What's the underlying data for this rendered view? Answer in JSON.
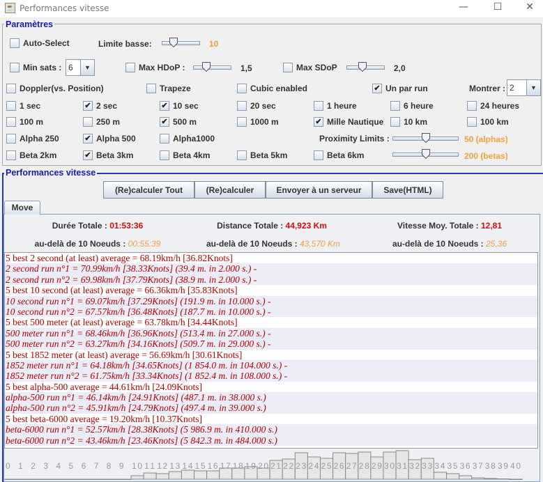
{
  "window": {
    "title": "Performances vitesse",
    "minimize": "—",
    "maximize": "☐",
    "close": "✕"
  },
  "params": {
    "title": "Paramètres",
    "auto_select": {
      "label": "Auto-Select",
      "checked": false
    },
    "limite_basse": {
      "label": "Limite basse:",
      "value": "10",
      "level": 0.25
    },
    "min_sats": {
      "label": "Min sats :",
      "checked": false,
      "value": "6"
    },
    "max_hdop": {
      "label": "Max HDoP :",
      "checked": false,
      "value": "1,5",
      "level": 0.3
    },
    "max_sdop": {
      "label": "Max SDoP",
      "checked": false,
      "value": "2,0",
      "level": 0.4
    },
    "doppler": {
      "label": "Doppler(vs. Position)",
      "checked": false
    },
    "trapeze": {
      "label": "Trapeze",
      "checked": false
    },
    "cubic": {
      "label": "Cubic enabled",
      "checked": false
    },
    "un_par_run": {
      "label": "Un par run",
      "checked": true
    },
    "montrer": {
      "label": "Montrer :",
      "value": "2"
    },
    "rows": [
      [
        {
          "label": "1 sec",
          "checked": false
        },
        {
          "label": "2 sec",
          "checked": true
        },
        {
          "label": "10 sec",
          "checked": true
        },
        {
          "label": "20 sec",
          "checked": false
        },
        {
          "label": "1 heure",
          "checked": false
        },
        {
          "label": "6 heure",
          "checked": false
        },
        {
          "label": "24 heures",
          "checked": false
        }
      ],
      [
        {
          "label": "100 m",
          "checked": false
        },
        {
          "label": "250 m",
          "checked": false
        },
        {
          "label": "500 m",
          "checked": true
        },
        {
          "label": "1000 m",
          "checked": false
        },
        {
          "label": "Mille Nautique",
          "checked": true
        },
        {
          "label": "10 km",
          "checked": false
        },
        {
          "label": "100 km",
          "checked": false
        }
      ],
      [
        {
          "label": "Alpha 250",
          "checked": false
        },
        {
          "label": "Alpha 500",
          "checked": true
        },
        {
          "label": "Alpha1000",
          "checked": false
        }
      ],
      [
        {
          "label": "Beta 2km",
          "checked": false
        },
        {
          "label": "Beta 3km",
          "checked": true
        },
        {
          "label": "Beta 4km",
          "checked": false
        },
        {
          "label": "Beta 5km",
          "checked": false
        },
        {
          "label": "Beta 6km",
          "checked": false
        }
      ]
    ],
    "proximity": {
      "label": "Proximity Limits :",
      "alpha_value": "50 (alphas)",
      "alpha_level": 0.5,
      "beta_value": "200 (betas)",
      "beta_level": 0.5
    }
  },
  "perf": {
    "title": "Performances vitesse",
    "buttons": [
      "(Re)calculer Tout",
      "(Re)calculer",
      "Envoyer à un serveur",
      "Save(HTML)"
    ],
    "tab": "Move",
    "stats": [
      {
        "label": "Durée Totale : ",
        "value": "01:53:36"
      },
      {
        "label": "Distance Totale : ",
        "value": "44,923 Km"
      },
      {
        "label": "Vitesse Moy. Totale : ",
        "value": "12,81"
      }
    ],
    "beyond": [
      {
        "label": "au-delà de  10 Noeuds : ",
        "value": "00:55:39"
      },
      {
        "label": "au-delà de  10 Noeuds : ",
        "value": "43,570 Km"
      },
      {
        "label": "au-delà de  10 Noeuds : ",
        "value": "25,36"
      }
    ],
    "lines": [
      {
        "text": "5 best 2 second (at least) average = 68.19km/h [36.82Knots]",
        "run": false
      },
      {
        "text": "2 second run n°1 = 70.99km/h [38.33Knots] (39.4 m. in 2.000 s.) -",
        "run": true
      },
      {
        "text": "2 second run n°2 = 69.98km/h [37.79Knots] (38.9 m. in 2.000 s.) -",
        "run": true
      },
      {
        "text": "5 best 10 second (at least) average = 66.36km/h [35.83Knots]",
        "run": false
      },
      {
        "text": "10 second run n°1 = 69.07km/h [37.29Knots] (191.9 m. in 10.000 s.) -",
        "run": true
      },
      {
        "text": "10 second run n°2 = 67.57km/h [36.48Knots] (187.7 m. in 10.000 s.) -",
        "run": true
      },
      {
        "text": "5 best 500 meter (at least) average = 63.78km/h [34.44Knots]",
        "run": false
      },
      {
        "text": "500 meter run n°1 = 68.46km/h [36.96Knots] (513.4 m. in 27.000 s.) -",
        "run": true
      },
      {
        "text": "500 meter run n°2 = 63.27km/h [34.16Knots] (509.7 m. in 29.000 s.) -",
        "run": true
      },
      {
        "text": "5 best 1852 meter (at least) average = 56.69km/h [30.61Knots]",
        "run": false
      },
      {
        "text": "1852 meter run n°1 = 64.18km/h [34.65Knots] (1 854.0 m. in 104.000 s.) -",
        "run": true
      },
      {
        "text": "1852 meter run n°2 = 61.75km/h [33.34Knots] (1 852.4 m. in 108.000 s.) -",
        "run": true
      },
      {
        "text": "5 best alpha-500 average = 44.61km/h [24.09Knots]",
        "run": false
      },
      {
        "text": "alpha-500 run n°1 = 46.14km/h [24.91Knots] (487.1 m. in 38.000 s.)",
        "run": true
      },
      {
        "text": "alpha-500 run n°2 = 45.91km/h [24.79Knots] (497.4 m. in 39.000 s.)",
        "run": true
      },
      {
        "text": "5 best beta-6000 average = 19.20km/h [10.37Knots]",
        "run": false
      },
      {
        "text": "beta-6000 run n°1 = 52.57km/h [28.38Knots] (5 986.9 m. in 410.000 s.)",
        "run": true
      },
      {
        "text": "beta-6000 run n°2 = 43.46km/h [23.46Knots] (5 842.3 m. in 484.000 s.)",
        "run": true
      }
    ]
  },
  "chart_data": {
    "type": "bar",
    "categories": [
      "0",
      "1",
      "2",
      "3",
      "4",
      "5",
      "6",
      "7",
      "8",
      "9",
      "10",
      "11",
      "12",
      "13",
      "14",
      "15",
      "16",
      "17",
      "18",
      "19",
      "20",
      "21",
      "22",
      "23",
      "24",
      "25",
      "26",
      "27",
      "28",
      "29",
      "30",
      "31",
      "32",
      "33",
      "34",
      "35",
      "36",
      "37",
      "38",
      "39",
      "40"
    ],
    "values": [
      0,
      0,
      0,
      0,
      0,
      0,
      0,
      0,
      0,
      0,
      5,
      9,
      8,
      11,
      13,
      12,
      12,
      16,
      16,
      18,
      16,
      27,
      29,
      38,
      32,
      30,
      38,
      37,
      39,
      32,
      39,
      41,
      28,
      30,
      10,
      8,
      5,
      2,
      1,
      0.5,
      0
    ],
    "ylim": [
      0,
      42
    ],
    "grid": false,
    "bar_color": "#e6e6e6"
  }
}
